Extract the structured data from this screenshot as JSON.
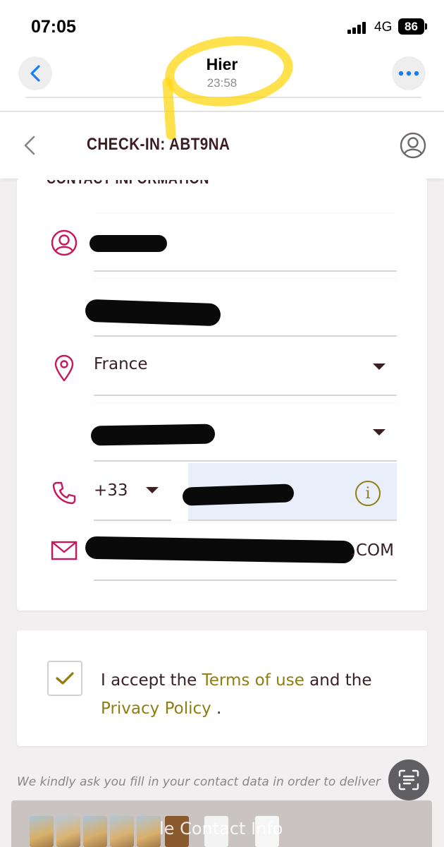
{
  "status_bar": {
    "time": "07:05",
    "network": "4G",
    "battery": "86"
  },
  "message_header": {
    "title": "Hier",
    "subtitle": "23:58"
  },
  "app_header": {
    "title": "CHECK-IN: ABT9NA"
  },
  "contact": {
    "section_title": "CONTACT INFORMATION",
    "country": "France",
    "phone_prefix": "+33",
    "email_suffix": ".COM"
  },
  "terms": {
    "prefix": "I accept the ",
    "terms_link": "Terms of use",
    "middle": " and the",
    "privacy_link": "Privacy Policy",
    "suffix": " ."
  },
  "footnote": "We kindly ask you fill in your contact data in order to deliver",
  "thumbnail_strip": {
    "partial_label": "le Contact Info"
  },
  "colors": {
    "accent_icon": "#c8175d",
    "link": "#8f7d12",
    "title": "#3d1d22"
  }
}
